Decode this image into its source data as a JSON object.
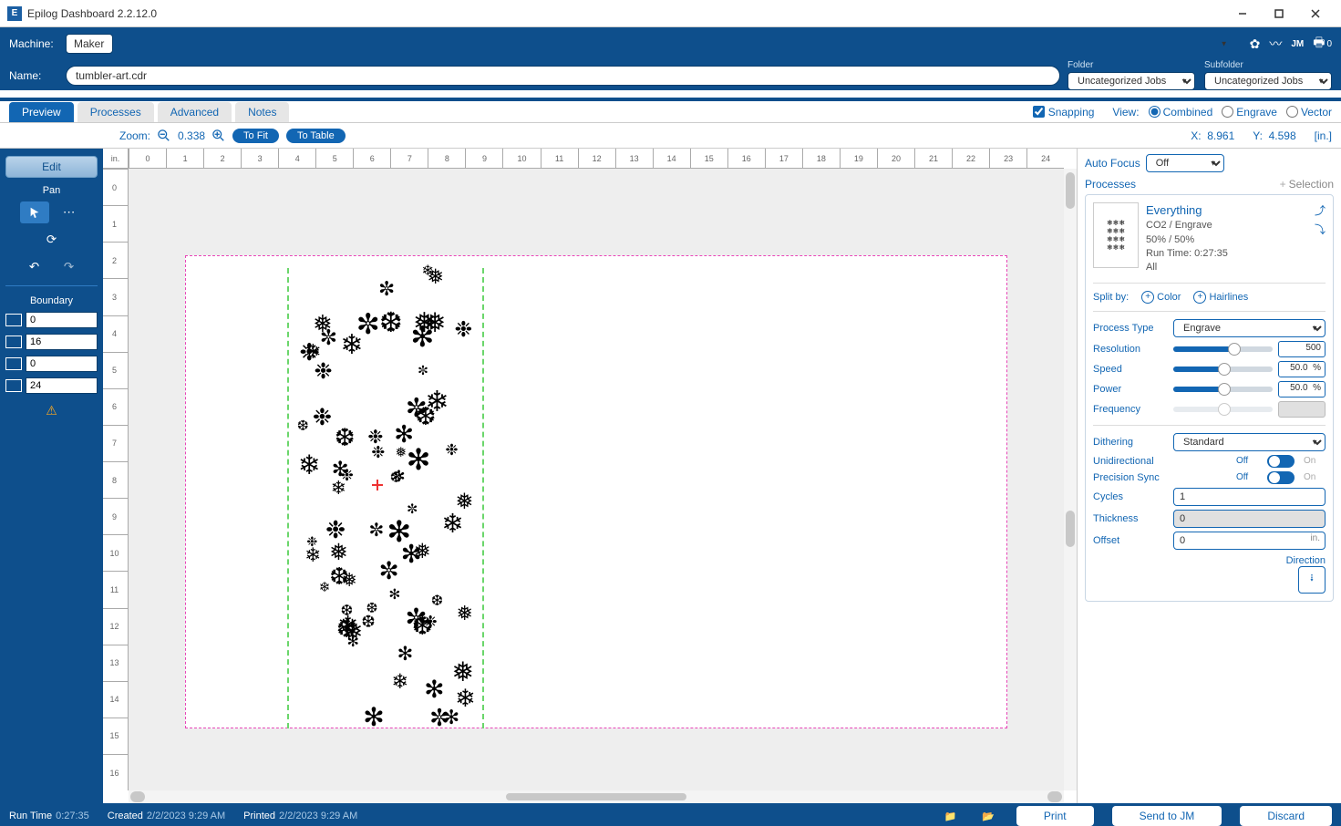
{
  "titlebar": {
    "app_title": "Epilog Dashboard 2.2.12.0",
    "app_icon_letter": "E"
  },
  "header": {
    "machine_label": "Machine:",
    "machine_value": "Maker",
    "name_label": "Name:",
    "name_value": "tumbler-art.cdr",
    "folder_label": "Folder",
    "folder_value": "Uncategorized Jobs",
    "subfolder_label": "Subfolder",
    "subfolder_value": "Uncategorized Jobs",
    "print_count": "0"
  },
  "tabs": {
    "items": [
      "Preview",
      "Processes",
      "Advanced",
      "Notes"
    ],
    "active": 0,
    "snapping_label": "Snapping",
    "view_label": "View:",
    "view_options": [
      "Combined",
      "Engrave",
      "Vector"
    ],
    "view_selected": 0
  },
  "zoom_bar": {
    "zoom_label": "Zoom:",
    "zoom_value": "0.338",
    "to_fit": "To Fit",
    "to_table": "To Table",
    "x_label": "X:",
    "x_value": "8.961",
    "y_label": "Y:",
    "y_value": "4.598",
    "unit": "[in.]"
  },
  "sidebar": {
    "edit": "Edit",
    "pan": "Pan",
    "boundary": "Boundary",
    "b_top": "0",
    "b_left": "16",
    "b_right": "0",
    "b_bottom": "24"
  },
  "ruler": {
    "unit": "in.",
    "h": [
      "0",
      "1",
      "2",
      "3",
      "4",
      "5",
      "6",
      "7",
      "8",
      "9",
      "10",
      "11",
      "12",
      "13",
      "14",
      "15",
      "16",
      "17",
      "18",
      "19",
      "20",
      "21",
      "22",
      "23",
      "24"
    ],
    "v": [
      "0",
      "1",
      "2",
      "3",
      "4",
      "5",
      "6",
      "7",
      "8",
      "9",
      "10",
      "11",
      "12",
      "13",
      "14",
      "15",
      "16"
    ]
  },
  "autofocus": {
    "label": "Auto Focus",
    "value": "Off"
  },
  "processes": {
    "title": "Processes",
    "selection_label": "Selection",
    "item": {
      "name": "Everything",
      "line1": "CO2 / Engrave",
      "line2": "50% / 50%",
      "line3": "Run Time: 0:27:35",
      "line4": "All"
    },
    "split_by": "Split by:",
    "color": "Color",
    "hairlines": "Hairlines",
    "process_type_label": "Process Type",
    "process_type_value": "Engrave",
    "resolution_label": "Resolution",
    "resolution_value": "500",
    "speed_label": "Speed",
    "speed_value": "50.0",
    "speed_unit": "%",
    "power_label": "Power",
    "power_value": "50.0",
    "power_unit": "%",
    "frequency_label": "Frequency",
    "frequency_value": "",
    "dithering_label": "Dithering",
    "dithering_value": "Standard",
    "unidir_label": "Unidirectional",
    "unidir_value": "Off",
    "unidir_alt": "On",
    "precsync_label": "Precision Sync",
    "precsync_value": "Off",
    "precsync_alt": "On",
    "cycles_label": "Cycles",
    "cycles_value": "1",
    "thickness_label": "Thickness",
    "thickness_value": "0",
    "offset_label": "Offset",
    "offset_value": "0",
    "offset_unit": "in.",
    "direction_label": "Direction"
  },
  "footer": {
    "runtime_label": "Run Time",
    "runtime_value": "0:27:35",
    "created_label": "Created",
    "created_value": "2/2/2023 9:29 AM",
    "printed_label": "Printed",
    "printed_value": "2/2/2023 9:29 AM",
    "print": "Print",
    "send_jm": "Send to JM",
    "discard": "Discard"
  }
}
